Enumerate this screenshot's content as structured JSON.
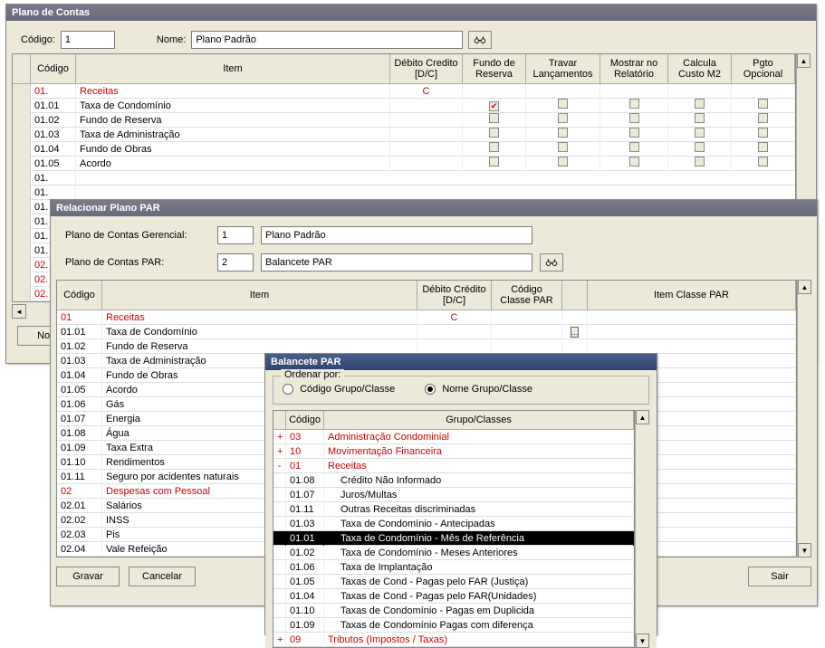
{
  "colors": {
    "red": "#c00"
  },
  "w1": {
    "title": "Plano de Contas",
    "codigo_label": "Código:",
    "codigo_value": "1",
    "nome_label": "Nome:",
    "nome_value": "Plano Padrão",
    "cols": {
      "codigo": "Código",
      "item": "Item",
      "dc": "Débito Credito [D/C]",
      "fr": "Fundo de Reserva",
      "trv": "Travar Lançamentos",
      "mst": "Mostrar no Relatório",
      "cal": "Calcula Custo M2",
      "pgt": "Pgto Opcional"
    },
    "rows": [
      {
        "cod": "01.",
        "item": "Receitas",
        "dc": "C",
        "red": true,
        "nochk": true
      },
      {
        "cod": "01.01",
        "item": "Taxa de Condomínio",
        "fr": true
      },
      {
        "cod": "01.02",
        "item": "Fundo de Reserva"
      },
      {
        "cod": "01.03",
        "item": "Taxa de Administração"
      },
      {
        "cod": "01.04",
        "item": "Fundo de Obras"
      },
      {
        "cod": "01.05",
        "item": "Acordo"
      }
    ],
    "tailcodes": [
      "01.",
      "01.",
      "01.",
      "01.",
      "01.",
      "01.",
      "02.",
      "02.",
      "02."
    ],
    "buttons": {
      "novo": "Novo"
    }
  },
  "w2": {
    "title": "Relacionar Plano PAR",
    "pcg_label": "Plano de Contas Gerencial:",
    "pcg_code": "1",
    "pcg_name": "Plano Padrão",
    "pcp_label": "Plano de Contas PAR:",
    "pcp_code": "2",
    "pcp_name": "Balancete PAR",
    "cols": {
      "codigo": "Código",
      "item": "Item",
      "dc": "Débito Crédito [D/C]",
      "cc": "Código Classe PAR",
      "icp": "Item Classe PAR"
    },
    "rows": [
      {
        "cod": "01",
        "item": "Receitas",
        "dc": "C",
        "red": true
      },
      {
        "cod": "01.01",
        "item": "Taxa de Condomínio",
        "btn": true
      },
      {
        "cod": "01.02",
        "item": "Fundo de Reserva"
      },
      {
        "cod": "01.03",
        "item": "Taxa de Administração"
      },
      {
        "cod": "01.04",
        "item": "Fundo de Obras"
      },
      {
        "cod": "01.05",
        "item": "Acordo"
      },
      {
        "cod": "01.06",
        "item": "Gás"
      },
      {
        "cod": "01.07",
        "item": "Energia"
      },
      {
        "cod": "01.08",
        "item": "Água"
      },
      {
        "cod": "01.09",
        "item": "Taxa Extra"
      },
      {
        "cod": "01.10",
        "item": "Rendimentos"
      },
      {
        "cod": "01.11",
        "item": "Seguro por acidentes naturais"
      },
      {
        "cod": "02",
        "item": "Despesas com Pessoal",
        "red": true
      },
      {
        "cod": "02.01",
        "item": "Salários"
      },
      {
        "cod": "02.02",
        "item": "INSS"
      },
      {
        "cod": "02.03",
        "item": "Pis"
      },
      {
        "cod": "02.04",
        "item": "Vale Refeição"
      }
    ],
    "buttons": {
      "gravar": "Gravar",
      "cancelar": "Cancelar",
      "sair": "Sair"
    }
  },
  "w3": {
    "title": "Balancete PAR",
    "ordenar_label": "Ordenar por:",
    "radio_codigo": "Código Grupo/Classe",
    "radio_nome": "Nome Grupo/Classe",
    "cols": {
      "codigo": "Código",
      "grupo": "Grupo/Classes"
    },
    "rows": [
      {
        "pm": "+",
        "cod": "03",
        "grp": "Administração Condominial",
        "red": true
      },
      {
        "pm": "+",
        "cod": "10",
        "grp": "Movimentação Financeira",
        "red": true
      },
      {
        "pm": "-",
        "cod": "01",
        "grp": "Receitas",
        "red": true
      },
      {
        "pm": "",
        "cod": "01.08",
        "grp": "Crédito Não Informado",
        "indent": true
      },
      {
        "pm": "",
        "cod": "01.07",
        "grp": "Juros/Multas",
        "indent": true
      },
      {
        "pm": "",
        "cod": "01.11",
        "grp": "Outras Receitas discriminadas",
        "indent": true
      },
      {
        "pm": "",
        "cod": "01.03",
        "grp": "Taxa de Condomínio - Antecipadas",
        "indent": true
      },
      {
        "pm": "",
        "cod": "01.01",
        "grp": "Taxa de Condomínio - Mês de Referência",
        "indent": true,
        "sel": true
      },
      {
        "pm": "",
        "cod": "01.02",
        "grp": "Taxa de Condomínio - Meses Anteriores",
        "indent": true
      },
      {
        "pm": "",
        "cod": "01.06",
        "grp": "Taxa de Implantação",
        "indent": true
      },
      {
        "pm": "",
        "cod": "01.05",
        "grp": "Taxas de Cond - Pagas pelo FAR (Justiça)",
        "indent": true
      },
      {
        "pm": "",
        "cod": "01.04",
        "grp": "Taxas de Cond - Pagas pelo FAR(Unidades)",
        "indent": true
      },
      {
        "pm": "",
        "cod": "01.10",
        "grp": "Taxas de Condomínio - Pagas em Duplicida",
        "indent": true
      },
      {
        "pm": "",
        "cod": "01.09",
        "grp": "Taxas de Condomínio Pagas com diferença",
        "indent": true
      },
      {
        "pm": "+",
        "cod": "09",
        "grp": "Tributos (Impostos / Taxas)",
        "red": true
      }
    ]
  }
}
